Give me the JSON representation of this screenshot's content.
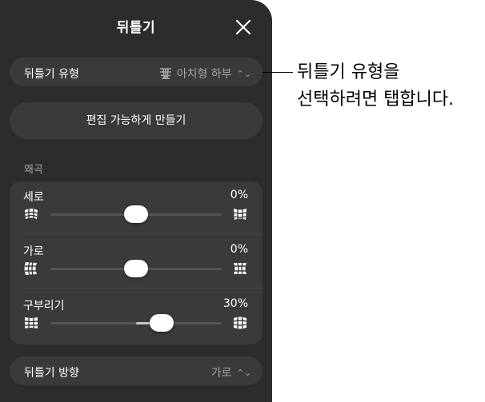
{
  "panel": {
    "title": "뒤틀기",
    "warp_type": {
      "label": "뒤틀기 유형",
      "value": "아치형 하부"
    },
    "make_editable": "편집 가능하게 만들기",
    "distortion_section": "왜곡",
    "sliders": [
      {
        "name": "세로",
        "value_text": "0%",
        "value": 0,
        "range": [
          -100,
          100
        ]
      },
      {
        "name": "가로",
        "value_text": "0%",
        "value": 0,
        "range": [
          -100,
          100
        ]
      },
      {
        "name": "구부리기",
        "value_text": "30%",
        "value": 30,
        "range": [
          -100,
          100
        ]
      }
    ],
    "warp_direction": {
      "label": "뒤틀기 방향",
      "value": "가로"
    }
  },
  "callout": {
    "line1": "뒤틀기 유형을",
    "line2": "선택하려면 탭합니다."
  },
  "icons": {
    "close": "close-icon",
    "warp_type": "arch-lower-icon",
    "chevron": "chevron-updown-icon"
  },
  "colors": {
    "panel_bg": "#2c2c2e",
    "control_bg": "#3a3a3c",
    "secondary_text": "#a6a6ab"
  }
}
